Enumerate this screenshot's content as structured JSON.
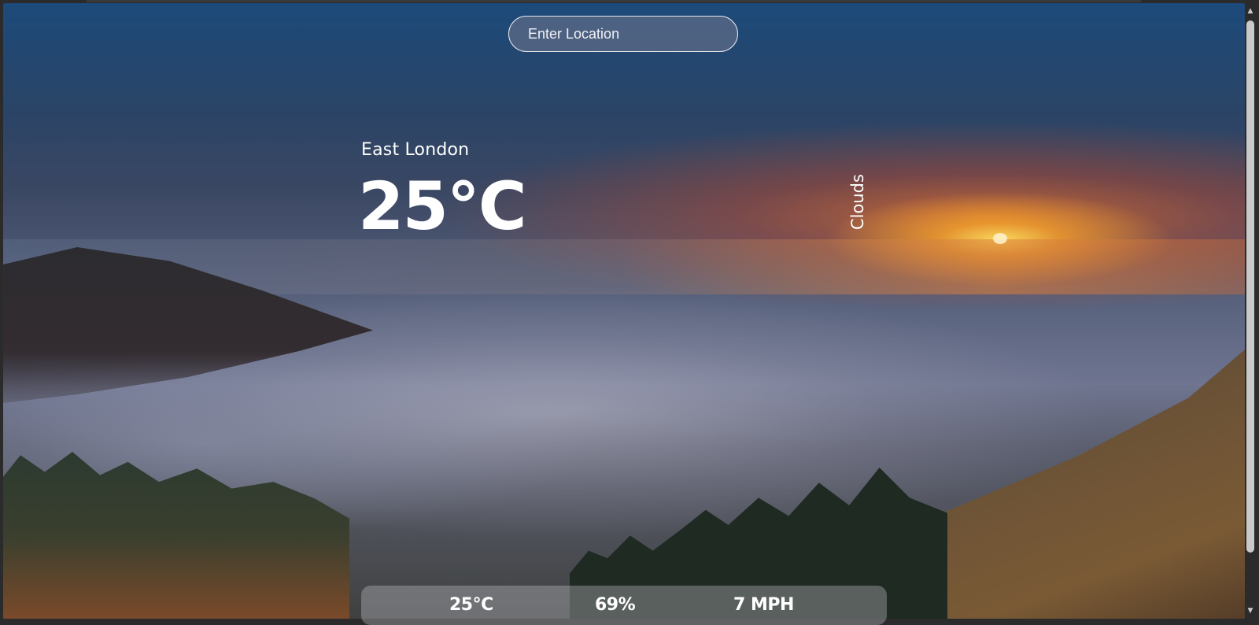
{
  "search": {
    "placeholder": "Enter Location"
  },
  "weather": {
    "city": "East London",
    "temperature": "25°C",
    "description": "Clouds"
  },
  "stats": {
    "feels_like": "25°C",
    "humidity": "69%",
    "wind": "7 MPH"
  },
  "icons": {
    "scroll_up": "scroll-up-arrow-icon",
    "scroll_down": "scroll-down-arrow-icon"
  },
  "colors": {
    "text": "#ffffff",
    "scrollbar": "#c9c9c9"
  }
}
